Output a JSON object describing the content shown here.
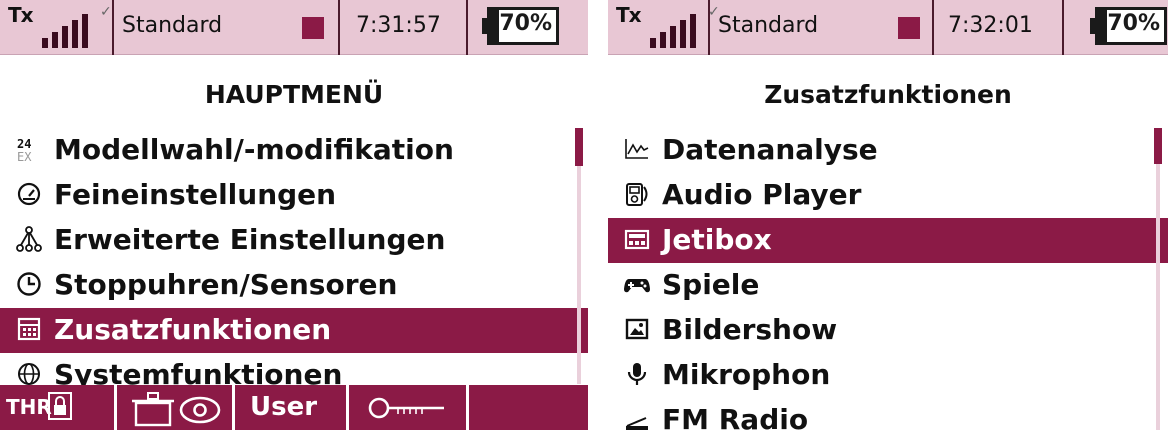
{
  "colors": {
    "accent": "#8b1a46",
    "status_bg": "#e8c7d4"
  },
  "screens": [
    {
      "status": {
        "tx": "Tx",
        "mode": "Standard",
        "time": "7:31:57",
        "battery": "70%",
        "battery_level": 0.7
      },
      "title": "HAUPTMENÜ",
      "menu": [
        {
          "label": "Modellwahl/-modifikation",
          "icon": "model-24ex-icon"
        },
        {
          "label": "Feineinstellungen",
          "icon": "gauge-icon"
        },
        {
          "label": "Erweiterte Einstellungen",
          "icon": "network-tree-icon"
        },
        {
          "label": "Stoppuhren/Sensoren",
          "icon": "clock-icon"
        },
        {
          "label": "Zusatzfunktionen",
          "icon": "calculator-icon",
          "selected": true
        },
        {
          "label": "Systemfunktionen",
          "icon": "globe-icon"
        }
      ],
      "bottom": {
        "thr": "THR",
        "user": "User"
      }
    },
    {
      "status": {
        "tx": "Tx",
        "mode": "Standard",
        "time": "7:32:01",
        "battery": "70%",
        "battery_level": 0.7
      },
      "title": "Zusatzfunktionen",
      "menu": [
        {
          "label": "Datenanalyse",
          "icon": "chart-icon"
        },
        {
          "label": "Audio Player",
          "icon": "audio-player-icon"
        },
        {
          "label": "Jetibox",
          "icon": "jetibox-icon",
          "selected": true
        },
        {
          "label": "Spiele",
          "icon": "gamepad-icon"
        },
        {
          "label": "Bildershow",
          "icon": "picture-icon"
        },
        {
          "label": "Mikrophon",
          "icon": "microphone-icon"
        },
        {
          "label": "FM Radio",
          "icon": "radio-icon"
        }
      ]
    }
  ]
}
